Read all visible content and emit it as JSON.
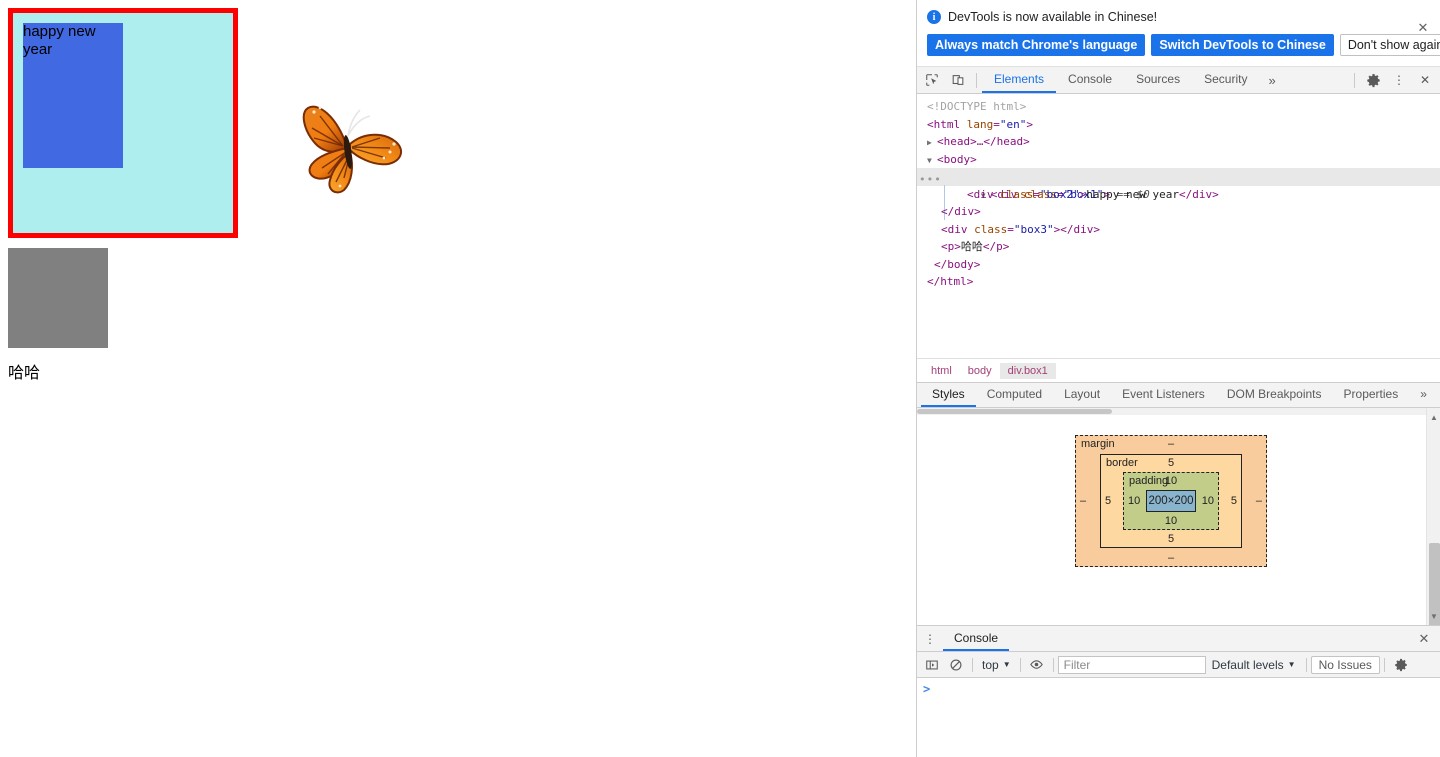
{
  "page": {
    "box1": {
      "class": "box1"
    },
    "box2": {
      "class": "box2",
      "text": "happy new year"
    },
    "box3": {
      "class": "box3"
    },
    "paragraph": "哈哈",
    "image_alt": "butterfly"
  },
  "colors": {
    "box1_background": "#afeeee",
    "box1_border": "#ff0000",
    "box2_background": "#4169e1",
    "box3_background": "#808080",
    "accent": "#1a73e8",
    "margin_layer": "#f9cc9d",
    "border_layer": "#fdd8a1",
    "padding_layer": "#c1cd89",
    "content_layer": "#89b4cd"
  },
  "banner": {
    "message": "DevTools is now available in Chinese!",
    "buttons": {
      "always_match": "Always match Chrome's language",
      "switch": "Switch DevTools to Chinese",
      "dont_show": "Don't show again"
    },
    "close": "✕",
    "info_icon": "i"
  },
  "toolbar": {
    "inspect_icon": "inspect-element-icon",
    "device_icon": "device-toolbar-icon",
    "tabs": [
      {
        "label": "Elements",
        "active": true
      },
      {
        "label": "Console",
        "active": false
      },
      {
        "label": "Sources",
        "active": false
      },
      {
        "label": "Security",
        "active": false
      }
    ],
    "more_tabs": "»",
    "settings_icon": "gear-icon",
    "kebab_icon": "⋮",
    "close_icon": "✕"
  },
  "dom_tree": {
    "doctype": "<!DOCTYPE html>",
    "lines": [
      {
        "text": "<html lang=\"en\">"
      },
      {
        "text": "<head>…</head>"
      },
      {
        "text": "<body>"
      },
      {
        "text": "<div class=\"box1\"> == $0",
        "selected": true
      },
      {
        "text": "<div class=\"box2\">happy new year</div>"
      },
      {
        "text": "</div>"
      },
      {
        "text": "<div class=\"box3\"></div>"
      },
      {
        "text": "<p>哈哈</p>"
      },
      {
        "text": "</body>"
      },
      {
        "text": "</html>"
      }
    ],
    "tokens": {
      "html_tag": "html",
      "lang_attr": "lang",
      "lang_value": "\"en\"",
      "head_tag": "head",
      "body_tag": "body",
      "div_tag": "div",
      "p_tag": "p",
      "class_attr": "class",
      "box1_value": "\"box1\"",
      "box2_value": "\"box2\"",
      "box3_value": "\"box3\"",
      "box2_text": "happy new year",
      "p_text": "哈哈",
      "selected_marker": "== $0",
      "dots": "•••"
    }
  },
  "breadcrumb": [
    {
      "label": "html",
      "active": false
    },
    {
      "label": "body",
      "active": false
    },
    {
      "label": "div.box1",
      "active": true
    }
  ],
  "styles_tabs": [
    {
      "label": "Styles",
      "active": true
    },
    {
      "label": "Computed",
      "active": false
    },
    {
      "label": "Layout",
      "active": false
    },
    {
      "label": "Event Listeners",
      "active": false
    },
    {
      "label": "DOM Breakpoints",
      "active": false
    },
    {
      "label": "Properties",
      "active": false
    }
  ],
  "styles_more": "»",
  "box_model": {
    "margin": {
      "label": "margin",
      "top": "–",
      "right": "–",
      "bottom": "–",
      "left": "–"
    },
    "border": {
      "label": "border",
      "top": "5",
      "right": "5",
      "bottom": "5",
      "left": "5"
    },
    "padding": {
      "label": "padding",
      "top": "10",
      "right": "10",
      "bottom": "10",
      "left": "10"
    },
    "content": {
      "size": "200×200"
    }
  },
  "drawer": {
    "kebab": "⋮",
    "tab": "Console",
    "close": "✕",
    "toolbar": {
      "sidebar_icon": "console-sidebar-icon",
      "clear_icon": "clear-console-icon",
      "context": "top",
      "context_caret": "▼",
      "eye_icon": "live-expression-icon",
      "filter_placeholder": "Filter",
      "levels": "Default levels",
      "levels_caret": "▼",
      "issues": "No Issues",
      "settings_icon": "gear-icon"
    },
    "prompt": ">"
  }
}
